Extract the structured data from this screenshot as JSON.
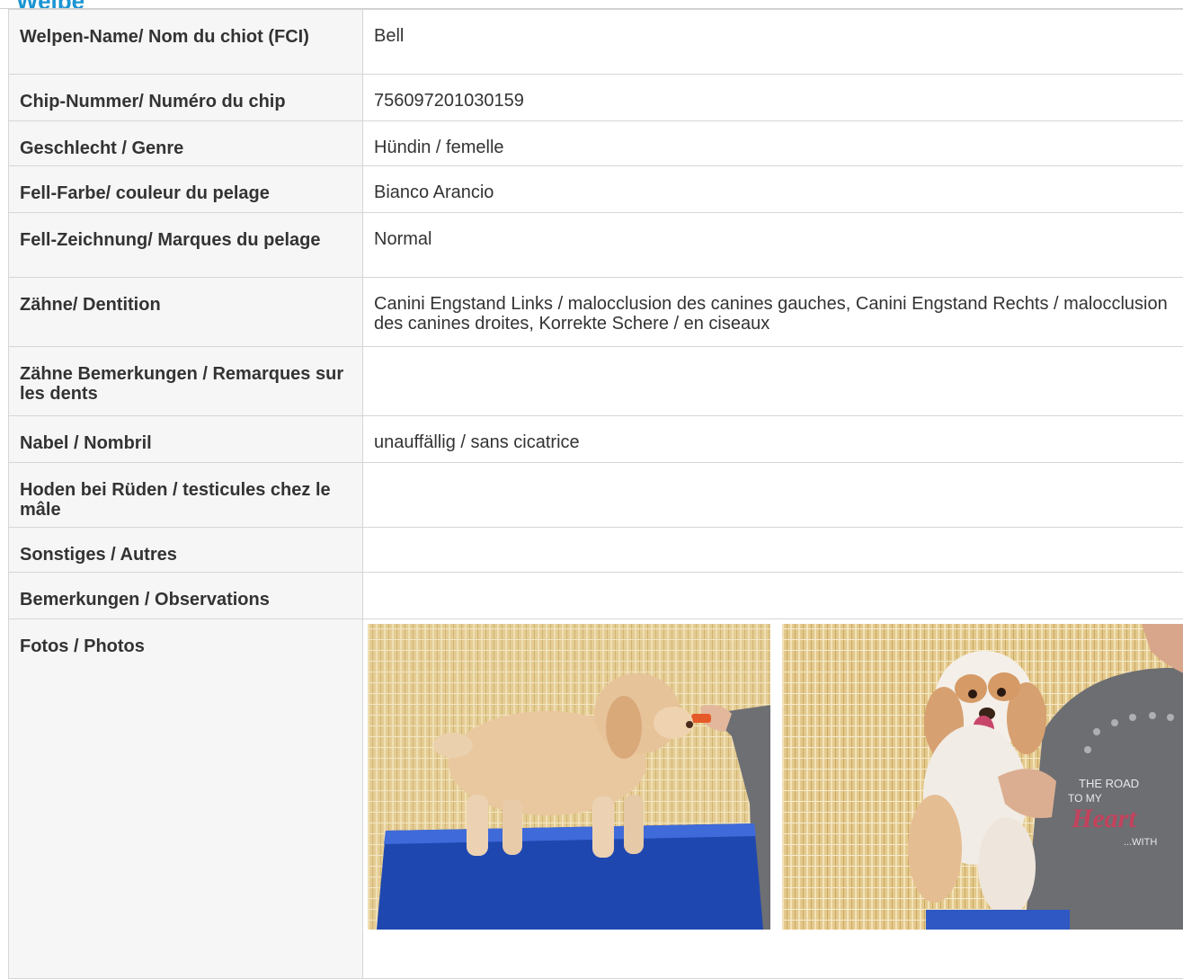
{
  "section": {
    "title": "Welpe"
  },
  "rows": [
    {
      "label": "Welpen-Name/ Nom du chiot (FCI)",
      "value": "Bell"
    },
    {
      "label": "Chip-Nummer/ Numéro du chip",
      "value": "756097201030159"
    },
    {
      "label": "Geschlecht / Genre",
      "value": "Hündin / femelle"
    },
    {
      "label": "Fell-Farbe/ couleur du pelage",
      "value": "Bianco Arancio"
    },
    {
      "label": "Fell-Zeichnung/ Marques du pelage",
      "value": "Normal"
    },
    {
      "label": "Zähne/ Dentition",
      "value": "Canini Engstand Links / malocclusion des canines gauches, Canini Engstand Rechts / malocclusion des canines droites, Korrekte Schere / en ciseaux"
    },
    {
      "label": "Zähne Bemerkungen / Remarques sur les dents",
      "value": ""
    },
    {
      "label": "Nabel / Nombril",
      "value": "unauffällig / sans cicatrice"
    },
    {
      "label": "Hoden bei Rüden / testicules chez le mâle",
      "value": ""
    },
    {
      "label": "Sonstiges / Autres",
      "value": ""
    },
    {
      "label": "Bemerkungen / Observations",
      "value": ""
    }
  ],
  "photos": {
    "label": "Fotos / Photos",
    "shirt_text": [
      "THE ROAD",
      "TO MY",
      "Heart",
      "...WITH"
    ]
  }
}
